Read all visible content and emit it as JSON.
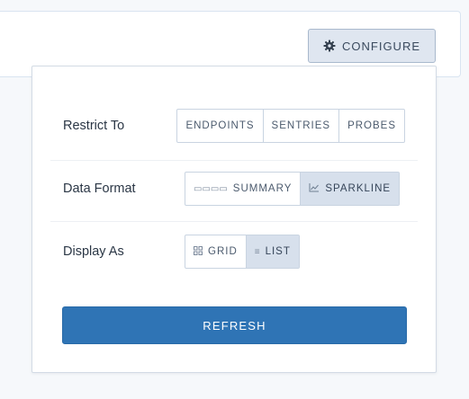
{
  "header": {
    "configure_label": "CONFIGURE",
    "configure_icon": "gear-icon"
  },
  "panel": {
    "restrict": {
      "label": "Restrict To",
      "options": [
        "ENDPOINTS",
        "SENTRIES",
        "PROBES"
      ],
      "selected": null
    },
    "format": {
      "label": "Data Format",
      "options": [
        {
          "icon": "summary-dots-icon",
          "glyph": "▭▭▭▭",
          "label": "SUMMARY"
        },
        {
          "icon": "sparkline-icon",
          "glyph": "⟋",
          "label": "SPARKLINE"
        }
      ],
      "selected": "SPARKLINE"
    },
    "display": {
      "label": "Display As",
      "options": [
        {
          "icon": "grid-icon",
          "glyph": "▦",
          "label": "GRID"
        },
        {
          "icon": "list-icon",
          "glyph": "≡",
          "label": "LIST"
        }
      ],
      "selected": "LIST"
    },
    "refresh_label": "REFRESH"
  },
  "colors": {
    "primary": "#2f74b5",
    "active_segment": "#d7e0ec",
    "border": "#c9d4e1"
  }
}
